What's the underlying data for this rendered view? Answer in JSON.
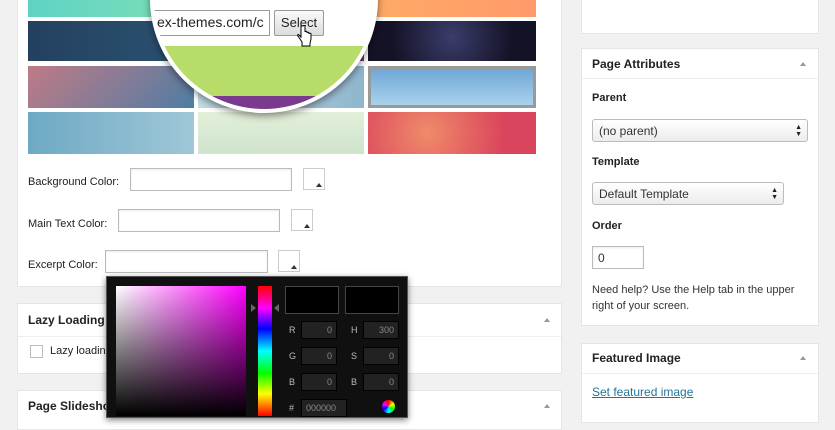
{
  "swatch_grid": {
    "rows": [
      [
        "#5fd3c3",
        "#2e8fc2",
        "#ffaa66"
      ],
      [
        "#23415e",
        "#6b3b74",
        "#1a1733"
      ],
      [
        "#c07a86",
        "#8fb6cc",
        "#6fa7d8"
      ],
      [
        "#6ea9c4",
        "#d6e8cc",
        "#e65c63"
      ]
    ]
  },
  "magnifier": {
    "url_text": "ex-themes.com/c",
    "select_button": "Select",
    "colors": {
      "top": "#58c9c0",
      "mid": "#b7dc6a",
      "bottom": "#7a3a8d"
    }
  },
  "color_fields": [
    {
      "label": "Background Color:",
      "value": ""
    },
    {
      "label": "Main Text Color:",
      "value": ""
    },
    {
      "label": "Excerpt Color:",
      "value": ""
    }
  ],
  "lazy_loading": {
    "title": "Lazy Loading",
    "checkbox_label": "Lazy loadin"
  },
  "page_slideshow": {
    "title": "Page Slidesho"
  },
  "color_picker": {
    "rows": [
      {
        "l": "R",
        "lv": "0",
        "r": "H",
        "rv": "300"
      },
      {
        "l": "G",
        "lv": "0",
        "r": "S",
        "rv": "0"
      },
      {
        "l": "B",
        "lv": "0",
        "r": "B",
        "rv": "0"
      }
    ],
    "hex_label": "#",
    "hex_value": "000000"
  },
  "page_attributes": {
    "title": "Page Attributes",
    "parent_label": "Parent",
    "parent_value": "(no parent)",
    "template_label": "Template",
    "template_value": "Default Template",
    "order_label": "Order",
    "order_value": "0",
    "help_text": "Need help? Use the Help tab in the upper right of your screen."
  },
  "featured_image": {
    "title": "Featured Image",
    "link": "Set featured image"
  }
}
